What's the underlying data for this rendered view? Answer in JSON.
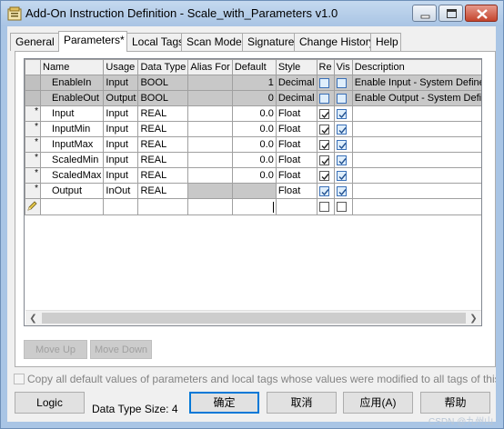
{
  "window": {
    "title": "Add-On Instruction Definition - Scale_with_Parameters v1.0"
  },
  "tabs": [
    {
      "label": "General"
    },
    {
      "label": "Parameters*"
    },
    {
      "label": "Local Tags"
    },
    {
      "label": "Scan Modes"
    },
    {
      "label": "Signature"
    },
    {
      "label": "Change History"
    },
    {
      "label": "Help"
    }
  ],
  "grid": {
    "columns": [
      "Name",
      "Usage",
      "Data Type",
      "Alias For",
      "Default",
      "Style",
      "Re",
      "Vis",
      "Description"
    ],
    "rows": [
      {
        "marker": "",
        "name": "EnableIn",
        "usage": "Input",
        "data_type": "BOOL",
        "alias_for": "",
        "default": "1",
        "style": "Decimal",
        "req": false,
        "vis": false,
        "description": "Enable Input - System Defined"
      },
      {
        "marker": "",
        "name": "EnableOut",
        "usage": "Output",
        "data_type": "BOOL",
        "alias_for": "",
        "default": "0",
        "style": "Decimal",
        "req": false,
        "vis": false,
        "description": "Enable Output - System Defined"
      },
      {
        "marker": "*",
        "name": "Input",
        "usage": "Input",
        "data_type": "REAL",
        "alias_for": "",
        "default": "0.0",
        "style": "Float",
        "req": true,
        "vis": true,
        "description": ""
      },
      {
        "marker": "*",
        "name": "InputMin",
        "usage": "Input",
        "data_type": "REAL",
        "alias_for": "",
        "default": "0.0",
        "style": "Float",
        "req": true,
        "vis": true,
        "description": ""
      },
      {
        "marker": "*",
        "name": "InputMax",
        "usage": "Input",
        "data_type": "REAL",
        "alias_for": "",
        "default": "0.0",
        "style": "Float",
        "req": true,
        "vis": true,
        "description": ""
      },
      {
        "marker": "*",
        "name": "ScaledMin",
        "usage": "Input",
        "data_type": "REAL",
        "alias_for": "",
        "default": "0.0",
        "style": "Float",
        "req": true,
        "vis": true,
        "description": ""
      },
      {
        "marker": "*",
        "name": "ScaledMax",
        "usage": "Input",
        "data_type": "REAL",
        "alias_for": "",
        "default": "0.0",
        "style": "Float",
        "req": true,
        "vis": true,
        "description": ""
      },
      {
        "marker": "*",
        "name": "Output",
        "usage": "InOut",
        "data_type": "REAL",
        "alias_for": "",
        "default": "",
        "style": "Float",
        "req": true,
        "vis": true,
        "description": ""
      }
    ]
  },
  "buttons": {
    "move_up": "Move Up",
    "move_down": "Move Down",
    "logic": "Logic",
    "ok": "确定",
    "cancel": "取消",
    "apply": "应用(A)",
    "help": "帮助"
  },
  "copy_defaults_label": "Copy all default values of parameters and local tags whose values were modified to all tags of this instruction",
  "data_type_size": "Data Type Size: 4",
  "watermark": "CSDN @九州山"
}
